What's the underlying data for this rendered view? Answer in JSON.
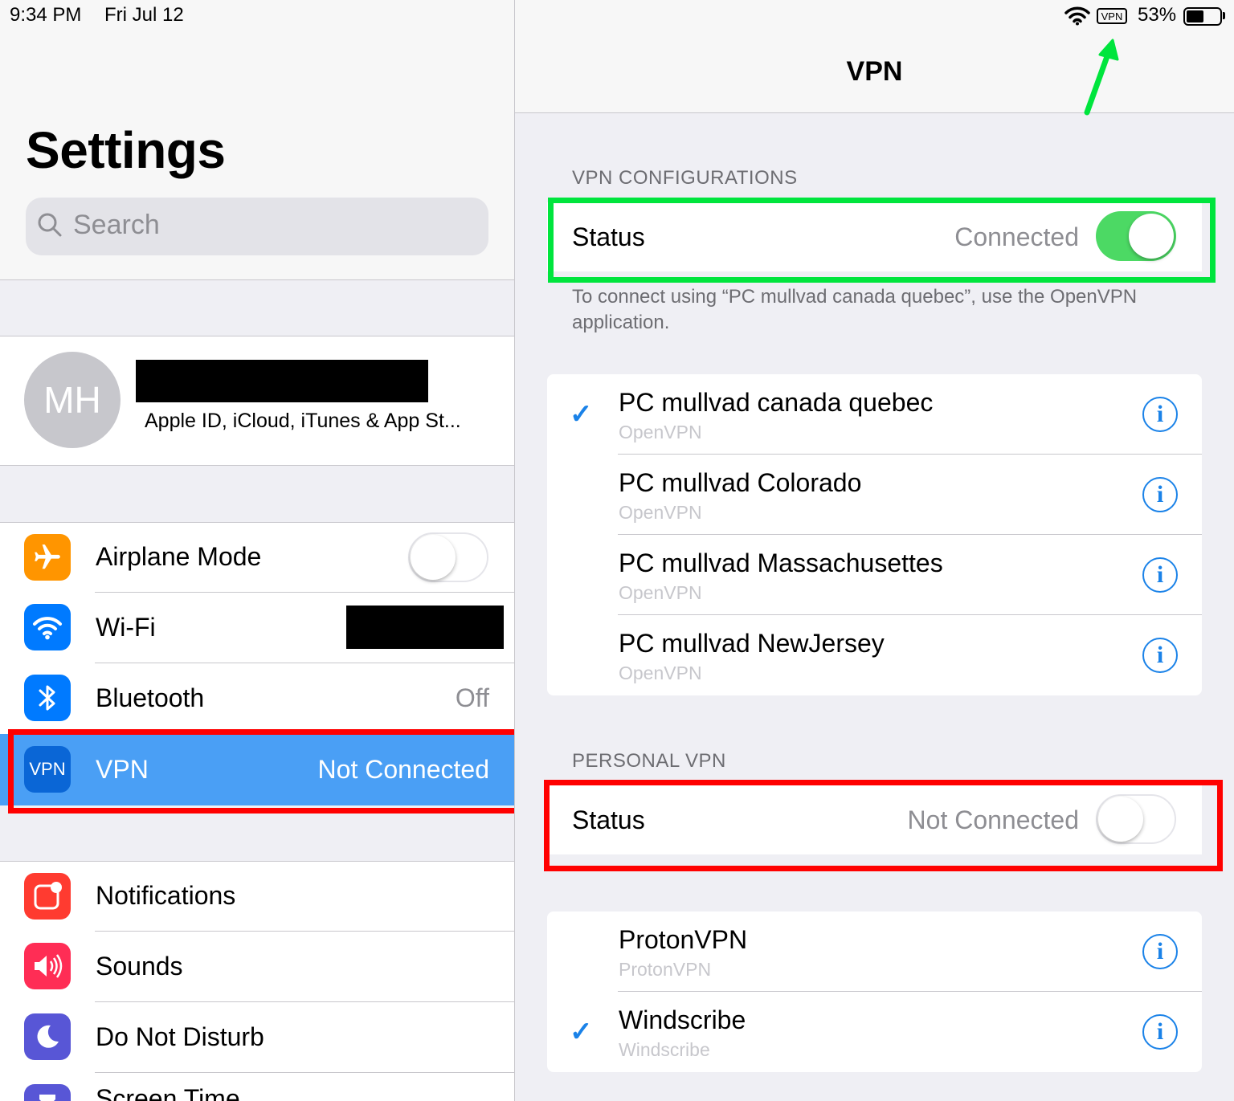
{
  "status_bar": {
    "time": "9:34 PM",
    "date": "Fri Jul 12",
    "vpn_indicator": "VPN",
    "battery": "53%",
    "battery_fill_fraction": 0.53
  },
  "sidebar": {
    "title": "Settings",
    "search_placeholder": "Search",
    "profile": {
      "initials": "MH",
      "name": "",
      "subtitle": "Apple ID, iCloud, iTunes & App St..."
    },
    "items": [
      {
        "label": "Airplane Mode",
        "icon": "airplane-icon",
        "color": "#ff9500",
        "value": "",
        "toggle_on": false
      },
      {
        "label": "Wi-Fi",
        "icon": "wifi-icon",
        "color": "#007aff",
        "value": ""
      },
      {
        "label": "Bluetooth",
        "icon": "bluetooth-icon",
        "color": "#007aff",
        "value": "Off"
      },
      {
        "label": "VPN",
        "icon": "vpn-icon",
        "icon_text": "VPN",
        "color": "#007aff",
        "value": "Not Connected",
        "selected": true
      },
      {
        "label": "Notifications",
        "icon": "notifications-icon",
        "color": "#ff3b30",
        "value": ""
      },
      {
        "label": "Sounds",
        "icon": "sounds-icon",
        "color": "#ff2d55",
        "value": ""
      },
      {
        "label": "Do Not Disturb",
        "icon": "moon-icon",
        "color": "#5856d6",
        "value": ""
      },
      {
        "label": "Screen Time",
        "icon": "hourglass-icon",
        "color": "#5856d6",
        "value": ""
      }
    ]
  },
  "detail": {
    "nav_title": "VPN",
    "vpn_configurations": {
      "header": "VPN CONFIGURATIONS",
      "status_label": "Status",
      "status_value": "Connected",
      "toggle_on": true,
      "footer": "To connect using “PC mullvad canada quebec”, use the OpenVPN application.",
      "configs": [
        {
          "name": "PC mullvad canada quebec",
          "type": "OpenVPN",
          "selected": true
        },
        {
          "name": "PC mullvad Colorado",
          "type": "OpenVPN",
          "selected": false
        },
        {
          "name": "PC mullvad Massachusettes",
          "type": "OpenVPN",
          "selected": false
        },
        {
          "name": "PC mullvad NewJersey",
          "type": "OpenVPN",
          "selected": false
        }
      ]
    },
    "personal_vpn": {
      "header": "PERSONAL VPN",
      "status_label": "Status",
      "status_value": "Not Connected",
      "toggle_on": false,
      "configs": [
        {
          "name": "ProtonVPN",
          "type": "ProtonVPN",
          "selected": false
        },
        {
          "name": "Windscribe",
          "type": "Windscribe",
          "selected": true
        }
      ]
    }
  },
  "annotations": {
    "green": "#00e53d",
    "red": "#ff0000"
  }
}
